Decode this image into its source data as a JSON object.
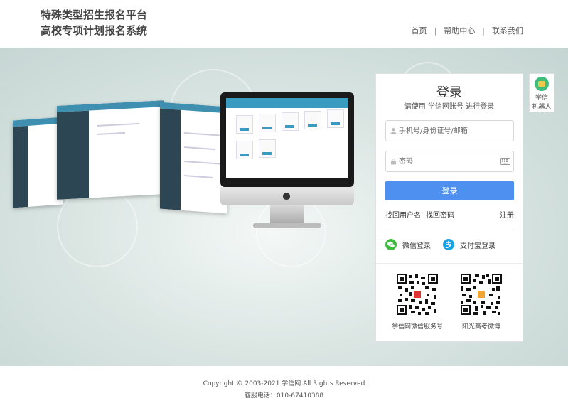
{
  "header": {
    "title_line1": "特殊类型招生报名平台",
    "title_line2": "高校专项计划报名系统",
    "nav": [
      "首页",
      "帮助中心",
      "联系我们"
    ]
  },
  "login": {
    "title": "登录",
    "subtitle": "请使用 学信网账号 进行登录",
    "username_placeholder": "手机号/身份证号/邮箱",
    "password_placeholder": "密码",
    "submit_label": "登录",
    "find_username": "找回用户名",
    "find_password": "找回密码",
    "register": "注册",
    "wechat_login": "微信登录",
    "alipay_login": "支付宝登录",
    "qr1_label": "学信网微信服务号",
    "qr2_label": "阳光高考微博"
  },
  "robot": {
    "label_line1": "学信",
    "label_line2": "机器人"
  },
  "footer": {
    "copyright": "Copyright © 2003-2021 学信网 All Rights Reserved",
    "phone": "客服电话：010-67410388"
  },
  "colors": {
    "primary": "#4d90f0",
    "wechat": "#3dbb3d",
    "alipay": "#1aa3e6",
    "hero": "#c4d5d2"
  },
  "icons": [
    "user-icon",
    "lock-icon",
    "keyboard-icon",
    "wechat-icon",
    "alipay-icon",
    "robot-icon",
    "qr-code"
  ]
}
